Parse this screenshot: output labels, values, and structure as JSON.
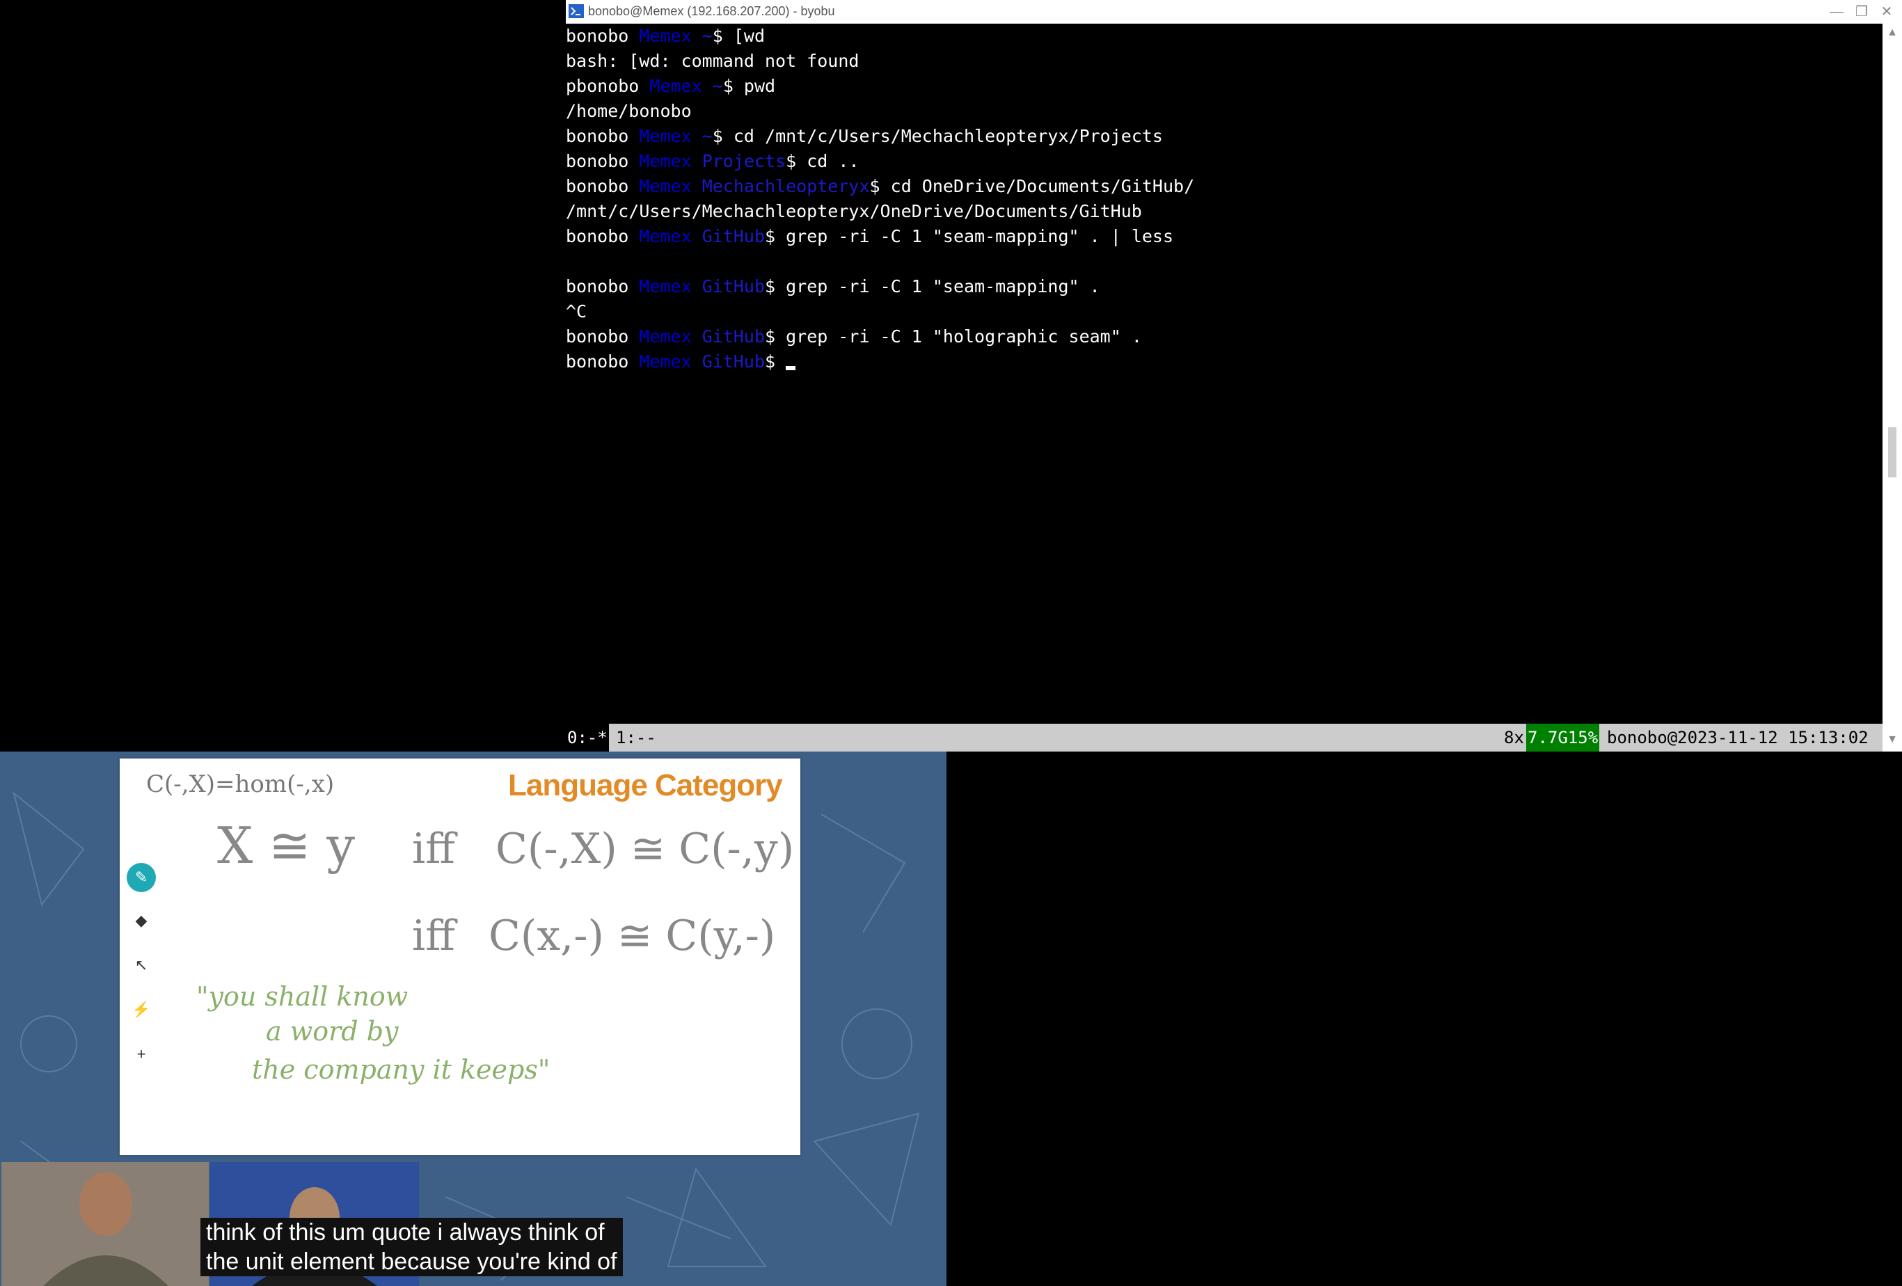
{
  "window": {
    "title": "bonobo@Memex (192.168.207.200) - byobu",
    "controls": [
      "—",
      "❐",
      "✕"
    ]
  },
  "terminal": {
    "lines": [
      {
        "user": "bonobo",
        "host": "Memex",
        "dir": "~",
        "prompt": "$",
        "cmd": " [wd"
      },
      {
        "text": "bash: [wd: command not found"
      },
      {
        "user": "pbonobo",
        "host": "Memex",
        "dir": "~",
        "prompt": "$",
        "cmd": " pwd"
      },
      {
        "text": "/home/bonobo"
      },
      {
        "user": "bonobo",
        "host": "Memex",
        "dir": "~",
        "prompt": "$",
        "cmd": " cd /mnt/c/Users/Mechachleopteryx/Projects"
      },
      {
        "user": "bonobo",
        "host": "Memex",
        "dir": "Projects",
        "prompt": "$",
        "cmd": " cd .."
      },
      {
        "user": "bonobo",
        "host": "Memex",
        "dir": "Mechachleopteryx",
        "prompt": "$",
        "cmd": " cd OneDrive/Documents/GitHub/"
      },
      {
        "text": "/mnt/c/Users/Mechachleopteryx/OneDrive/Documents/GitHub"
      },
      {
        "user": "bonobo",
        "host": "Memex",
        "dir": "GitHub",
        "prompt": "$",
        "cmd": " grep -ri -C 1 \"seam-mapping\" . | less"
      },
      {
        "text": ""
      },
      {
        "user": "bonobo",
        "host": "Memex",
        "dir": "GitHub",
        "prompt": "$",
        "cmd": " grep -ri -C 1 \"seam-mapping\" ."
      },
      {
        "text": "^C"
      },
      {
        "user": "bonobo",
        "host": "Memex",
        "dir": "GitHub",
        "prompt": "$",
        "cmd": " grep -ri -C 1 \"holographic seam\" ."
      },
      {
        "user": "bonobo",
        "host": "Memex",
        "dir": "GitHub",
        "prompt": "$",
        "cmd": " ",
        "cursor": true
      }
    ]
  },
  "statusbar": {
    "window0": "0:-*",
    "window1": "1:--",
    "load": "8x",
    "mem": "7.7G15%",
    "host_time": "bonobo@2023-11-12 15:13:02"
  },
  "video": {
    "slide_title": "Language Category",
    "handwriting": {
      "corner": "C(-,X)=hom(-,x)",
      "line1_left": "X ≅ y",
      "iff1": "iff",
      "line1_right": "C(-,X) ≅ C(-,y)",
      "iff2": "iff",
      "line2_right": "C(x,-) ≅ C(y,-)",
      "quote1": "\"you shall know",
      "quote2": "a word by",
      "quote3": "the company it keeps\""
    },
    "tools": [
      "pen-icon",
      "eraser-icon",
      "pointer-icon",
      "laser-icon",
      "plus-icon"
    ],
    "caption": [
      "think of this um quote i always think of",
      "the unit element because you're kind of"
    ]
  }
}
